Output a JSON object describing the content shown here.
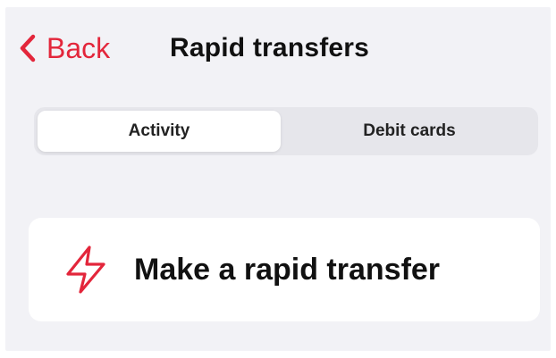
{
  "header": {
    "back_label": "Back",
    "title": "Rapid transfers"
  },
  "tabs": [
    {
      "label": "Activity",
      "selected": true
    },
    {
      "label": "Debit cards",
      "selected": false
    }
  ],
  "action": {
    "label": "Make a rapid transfer",
    "icon": "lightning-bolt-icon"
  },
  "colors": {
    "accent": "#e3263b",
    "background": "#f2f2f6",
    "card": "#ffffff",
    "segment_track": "#e6e6eb"
  }
}
